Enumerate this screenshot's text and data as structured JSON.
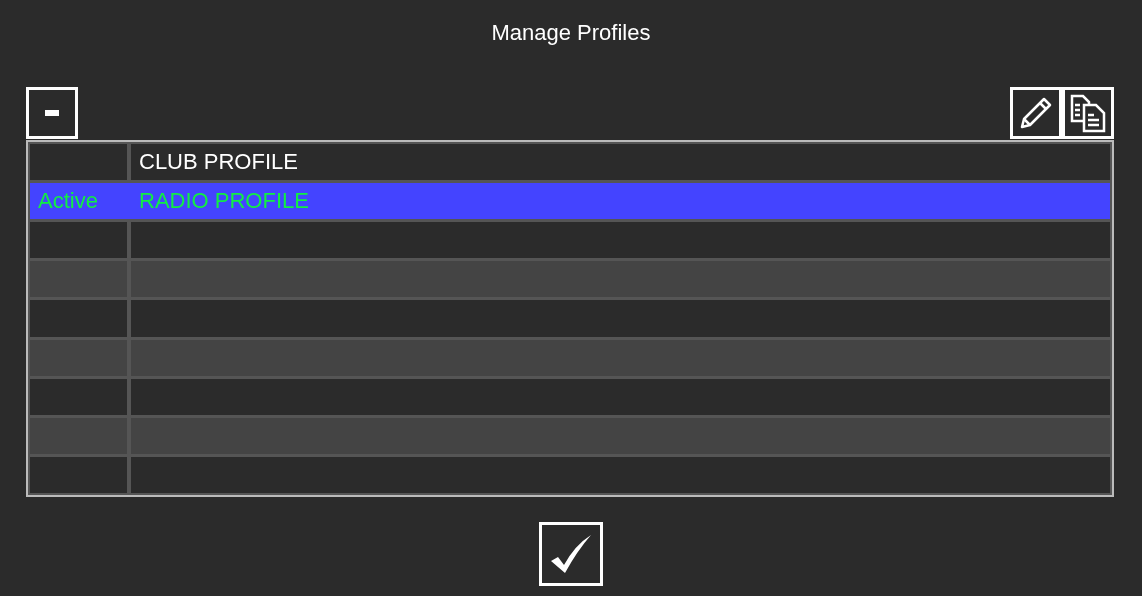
{
  "window": {
    "title": "Manage Profiles"
  },
  "profiles": [
    {
      "name": "CLUB PROFILE",
      "selected": false
    },
    {
      "status": "Active",
      "name": "RADIO PROFILE",
      "selected": true
    }
  ]
}
